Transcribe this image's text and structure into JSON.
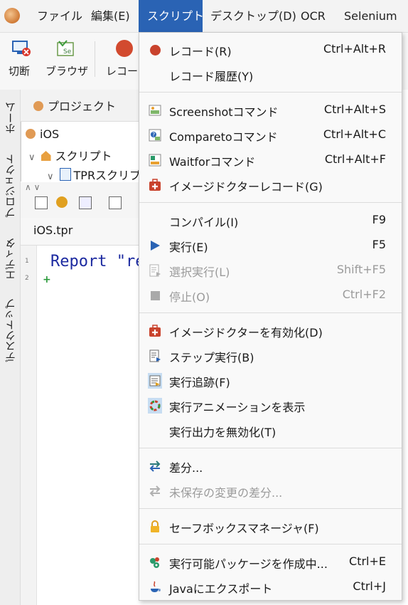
{
  "menubar": {
    "items": [
      "ファイル",
      "編集(E)",
      "スクリプト",
      "デスクトップ(D)",
      "OCR",
      "Selenium"
    ],
    "active_index": 2
  },
  "toolbar": {
    "disconnect": "切断",
    "browser": "ブラウザ",
    "record": "レコード"
  },
  "side_tabs": [
    "ホーム",
    "プロジェクト",
    "エディタ",
    "デスクトップ"
  ],
  "project_panel": {
    "tab": "プロジェクト",
    "tree": [
      "iOS",
      "スクリプト",
      "TPRスクリプ"
    ]
  },
  "editor": {
    "file_tab": "iOS.tpr",
    "line_numbers": [
      "1",
      "2"
    ],
    "code_line": "Report \"re"
  },
  "dropdown": {
    "sections": [
      [
        {
          "label": "レコード(R)",
          "shortcut": "Ctrl+Alt+R",
          "icon": "record-icon",
          "disabled": false
        },
        {
          "label": "レコード履歴(Y)",
          "shortcut": "",
          "icon": "",
          "disabled": false
        }
      ],
      [
        {
          "label": "Screenshotコマンド",
          "shortcut": "Ctrl+Alt+S",
          "icon": "screenshot-icon",
          "disabled": false
        },
        {
          "label": "Comparetoコマンド",
          "shortcut": "Ctrl+Alt+C",
          "icon": "compare-icon",
          "disabled": false
        },
        {
          "label": "Waitforコマンド",
          "shortcut": "Ctrl+Alt+F",
          "icon": "waitfor-icon",
          "disabled": false
        },
        {
          "label": "イメージドクターレコード(G)",
          "shortcut": "",
          "icon": "image-doctor-icon",
          "disabled": false
        }
      ],
      [
        {
          "label": "コンパイル(I)",
          "shortcut": "F9",
          "icon": "",
          "disabled": false
        },
        {
          "label": "実行(E)",
          "shortcut": "F5",
          "icon": "play-icon",
          "disabled": false
        },
        {
          "label": "選択実行(L)",
          "shortcut": "Shift+F5",
          "icon": "run-selection-icon",
          "disabled": true
        },
        {
          "label": "停止(O)",
          "shortcut": "Ctrl+F2",
          "icon": "stop-icon",
          "disabled": true
        }
      ],
      [
        {
          "label": "イメージドクターを有効化(D)",
          "shortcut": "",
          "icon": "image-doctor-icon",
          "disabled": false
        },
        {
          "label": "ステップ実行(B)",
          "shortcut": "",
          "icon": "step-icon",
          "disabled": false
        },
        {
          "label": "実行追跡(F)",
          "shortcut": "",
          "icon": "trace-icon",
          "disabled": false
        },
        {
          "label": "実行アニメーションを表示",
          "shortcut": "",
          "icon": "animation-icon",
          "disabled": false
        },
        {
          "label": "実行出力を無効化(T)",
          "shortcut": "",
          "icon": "",
          "disabled": false
        }
      ],
      [
        {
          "label": "差分...",
          "shortcut": "",
          "icon": "diff-icon",
          "disabled": false
        },
        {
          "label": "未保存の変更の差分...",
          "shortcut": "",
          "icon": "diff-unsaved-icon",
          "disabled": true
        }
      ],
      [
        {
          "label": "セーフボックスマネージャ(F)",
          "shortcut": "",
          "icon": "lock-icon",
          "disabled": false
        }
      ],
      [
        {
          "label": "実行可能パッケージを作成中...",
          "shortcut": "Ctrl+E",
          "icon": "package-icon",
          "disabled": false
        },
        {
          "label": "Javaにエクスポート",
          "shortcut": "Ctrl+J",
          "icon": "java-icon",
          "disabled": false
        }
      ]
    ]
  }
}
